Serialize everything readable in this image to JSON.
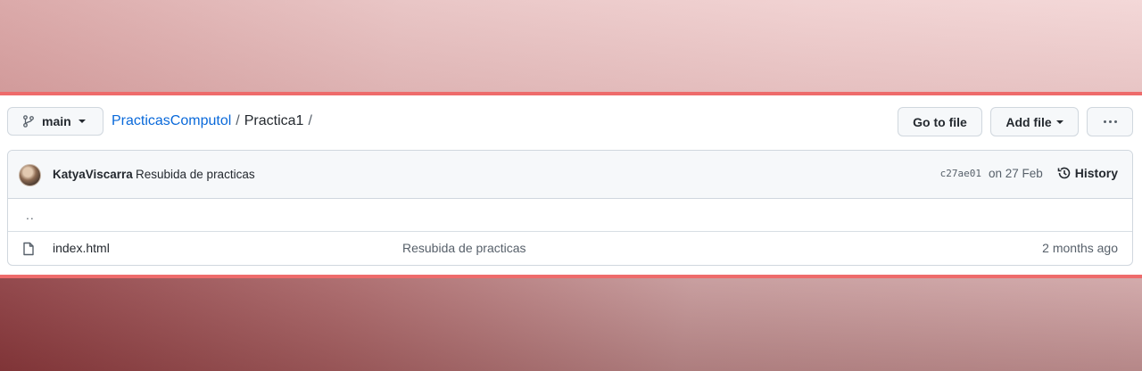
{
  "branch": {
    "label": "main",
    "icon": "git-branch-icon"
  },
  "breadcrumb": {
    "repo": "PracticasComputol",
    "separator": "/",
    "folder": "Practica1",
    "trailing_separator": "/"
  },
  "actions": {
    "go_to_file": "Go to file",
    "add_file": "Add file",
    "more": "more-options-icon"
  },
  "commit": {
    "author": "KatyaViscarra",
    "message": "Resubida de practicas",
    "sha": "c27ae01",
    "date": "on 27 Feb",
    "history_label": "History"
  },
  "files": {
    "parent": "..",
    "items": [
      {
        "name": "index.html",
        "icon": "file-icon",
        "commit_message": "Resubida de practicas",
        "age": "2 months ago"
      }
    ]
  },
  "colors": {
    "accent": "#0969da",
    "border": "#d0d7de",
    "frame_line": "#ee6b6b"
  }
}
